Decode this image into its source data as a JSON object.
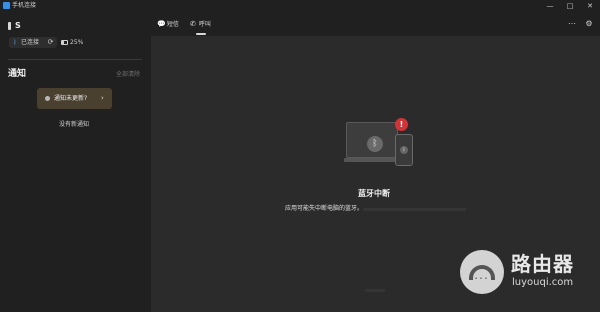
{
  "window": {
    "title": "手机连接",
    "minimize_glyph": "—",
    "maximize_glyph": "□",
    "close_glyph": "✕"
  },
  "sidebar": {
    "device_name": "S",
    "connection_status": "已连接",
    "bluetooth_glyph": "ᛒ",
    "sync_glyph": "⟳",
    "battery": "25%",
    "notifications_title": "通知",
    "clear_all": "全部清除",
    "notification_card": {
      "text": "通知未更新?",
      "chevron": "›"
    },
    "no_new": "没有新通知"
  },
  "tabs": {
    "items": [
      {
        "label": "短信",
        "icon": "💬"
      },
      {
        "label": "呼叫",
        "icon": "✆"
      }
    ],
    "active_index": 1,
    "more_glyph": "⋯",
    "settings_glyph": "⚙"
  },
  "main": {
    "bluetooth_glyph": "ᛒ",
    "alert_glyph": "!",
    "title": "蓝牙中断",
    "description": "应用可能失中断电脑的蓝牙。"
  },
  "watermark": {
    "cn": "路由器",
    "en": "luyouqi.com"
  },
  "colors": {
    "accent": "#3a8fe0",
    "alert": "#d13438",
    "card": "#4a4030",
    "background": "#202020",
    "panel": "#2b2b2b"
  }
}
